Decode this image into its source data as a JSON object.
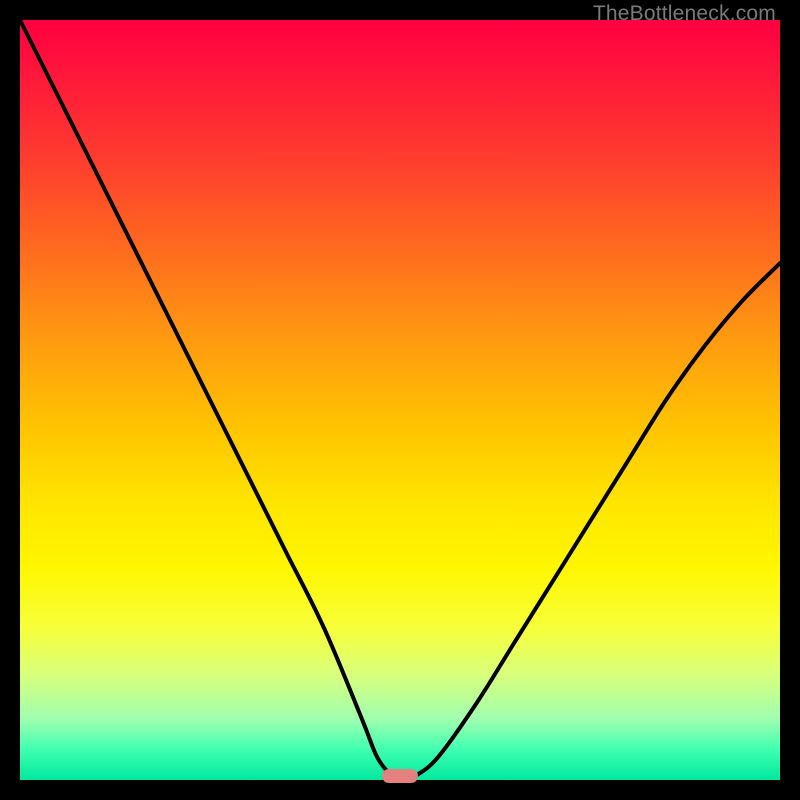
{
  "watermark": "TheBottleneck.com",
  "colors": {
    "frame": "#000000",
    "curve_stroke": "#000000",
    "marker_fill": "#e38080",
    "gradient_top": "#ff0040",
    "gradient_bottom": "#00e8a0"
  },
  "chart_data": {
    "type": "line",
    "title": "",
    "xlabel": "",
    "ylabel": "",
    "xlim": [
      0,
      100
    ],
    "ylim": [
      0,
      100
    ],
    "grid": false,
    "series": [
      {
        "name": "bottleneck-curve",
        "x": [
          0,
          5,
          10,
          15,
          20,
          25,
          30,
          35,
          40,
          45,
          47,
          49,
          50,
          51,
          52,
          55,
          60,
          65,
          70,
          75,
          80,
          85,
          90,
          95,
          100
        ],
        "y": [
          100,
          90,
          80,
          70,
          60,
          50,
          40,
          30,
          20,
          8,
          3,
          0.5,
          0,
          0,
          0.5,
          3,
          10,
          18,
          26,
          34,
          42,
          50,
          57,
          63,
          68
        ]
      }
    ],
    "marker": {
      "x": 50,
      "y": 0
    },
    "notes": "y represents bottleneck percentage; valley floor flat near x=49–52; right branch does not reach top"
  }
}
